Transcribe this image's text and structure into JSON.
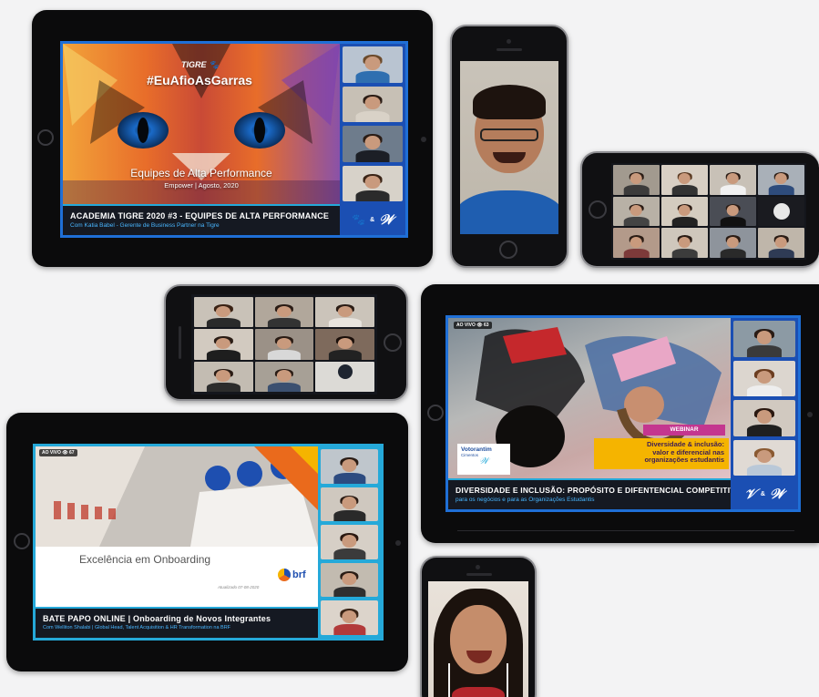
{
  "tablet1": {
    "brand": "TIGRE",
    "hashtag": "#EuAfioAsGarras",
    "slide_title": "Equipes de Alta Performance",
    "slide_sub": "Empower | Agosto, 2020",
    "bar_title": "ACADEMIA TIGRE 2020 #3 - EQUIPES DE ALTA PERFORMANCE",
    "bar_sub": "Com Katia Babel - Gerente de Business Partner na Tigre",
    "amp": "&"
  },
  "tablet2": {
    "live_badge": "AO VIVO",
    "viewers": "63",
    "webinar_label": "WEBINAR",
    "banner_line1": "Diversidade & inclusão:",
    "banner_line2": "valor e diferencial nas",
    "banner_line3": "organizações estudantis",
    "sponsor": "Votorantim",
    "sponsor_sub": "Cimentos",
    "bar_title": "DIVERSIDADE E INCLUSÃO: PROPÓSITO E DIFENTENCIAL COMPETITIVO",
    "bar_sub": "para os negócios e para as Organizações Estudantis",
    "amp": "&"
  },
  "tablet3": {
    "live_badge": "AO VIVO",
    "viewers": "67",
    "slide_title": "Excelência em Onboarding",
    "slide_date": "Atualizado 07-08-2020",
    "brand": "brf",
    "bar_title": "BATE PAPO ONLINE | Onboarding de Novos Integrantes",
    "bar_sub": "Com Welliton Shalabi  |  Global Head, Talent Acquisition & HR Transformation na BRF"
  },
  "colors": {
    "stream_blue": "#1b4fb3",
    "accent_cyan": "#25a9d9",
    "banner_yellow": "#f5b400",
    "webinar_pink": "#c4368f"
  },
  "icons": {
    "tigre_paw": "paw-icon",
    "empower_logo": "logo-icon"
  }
}
